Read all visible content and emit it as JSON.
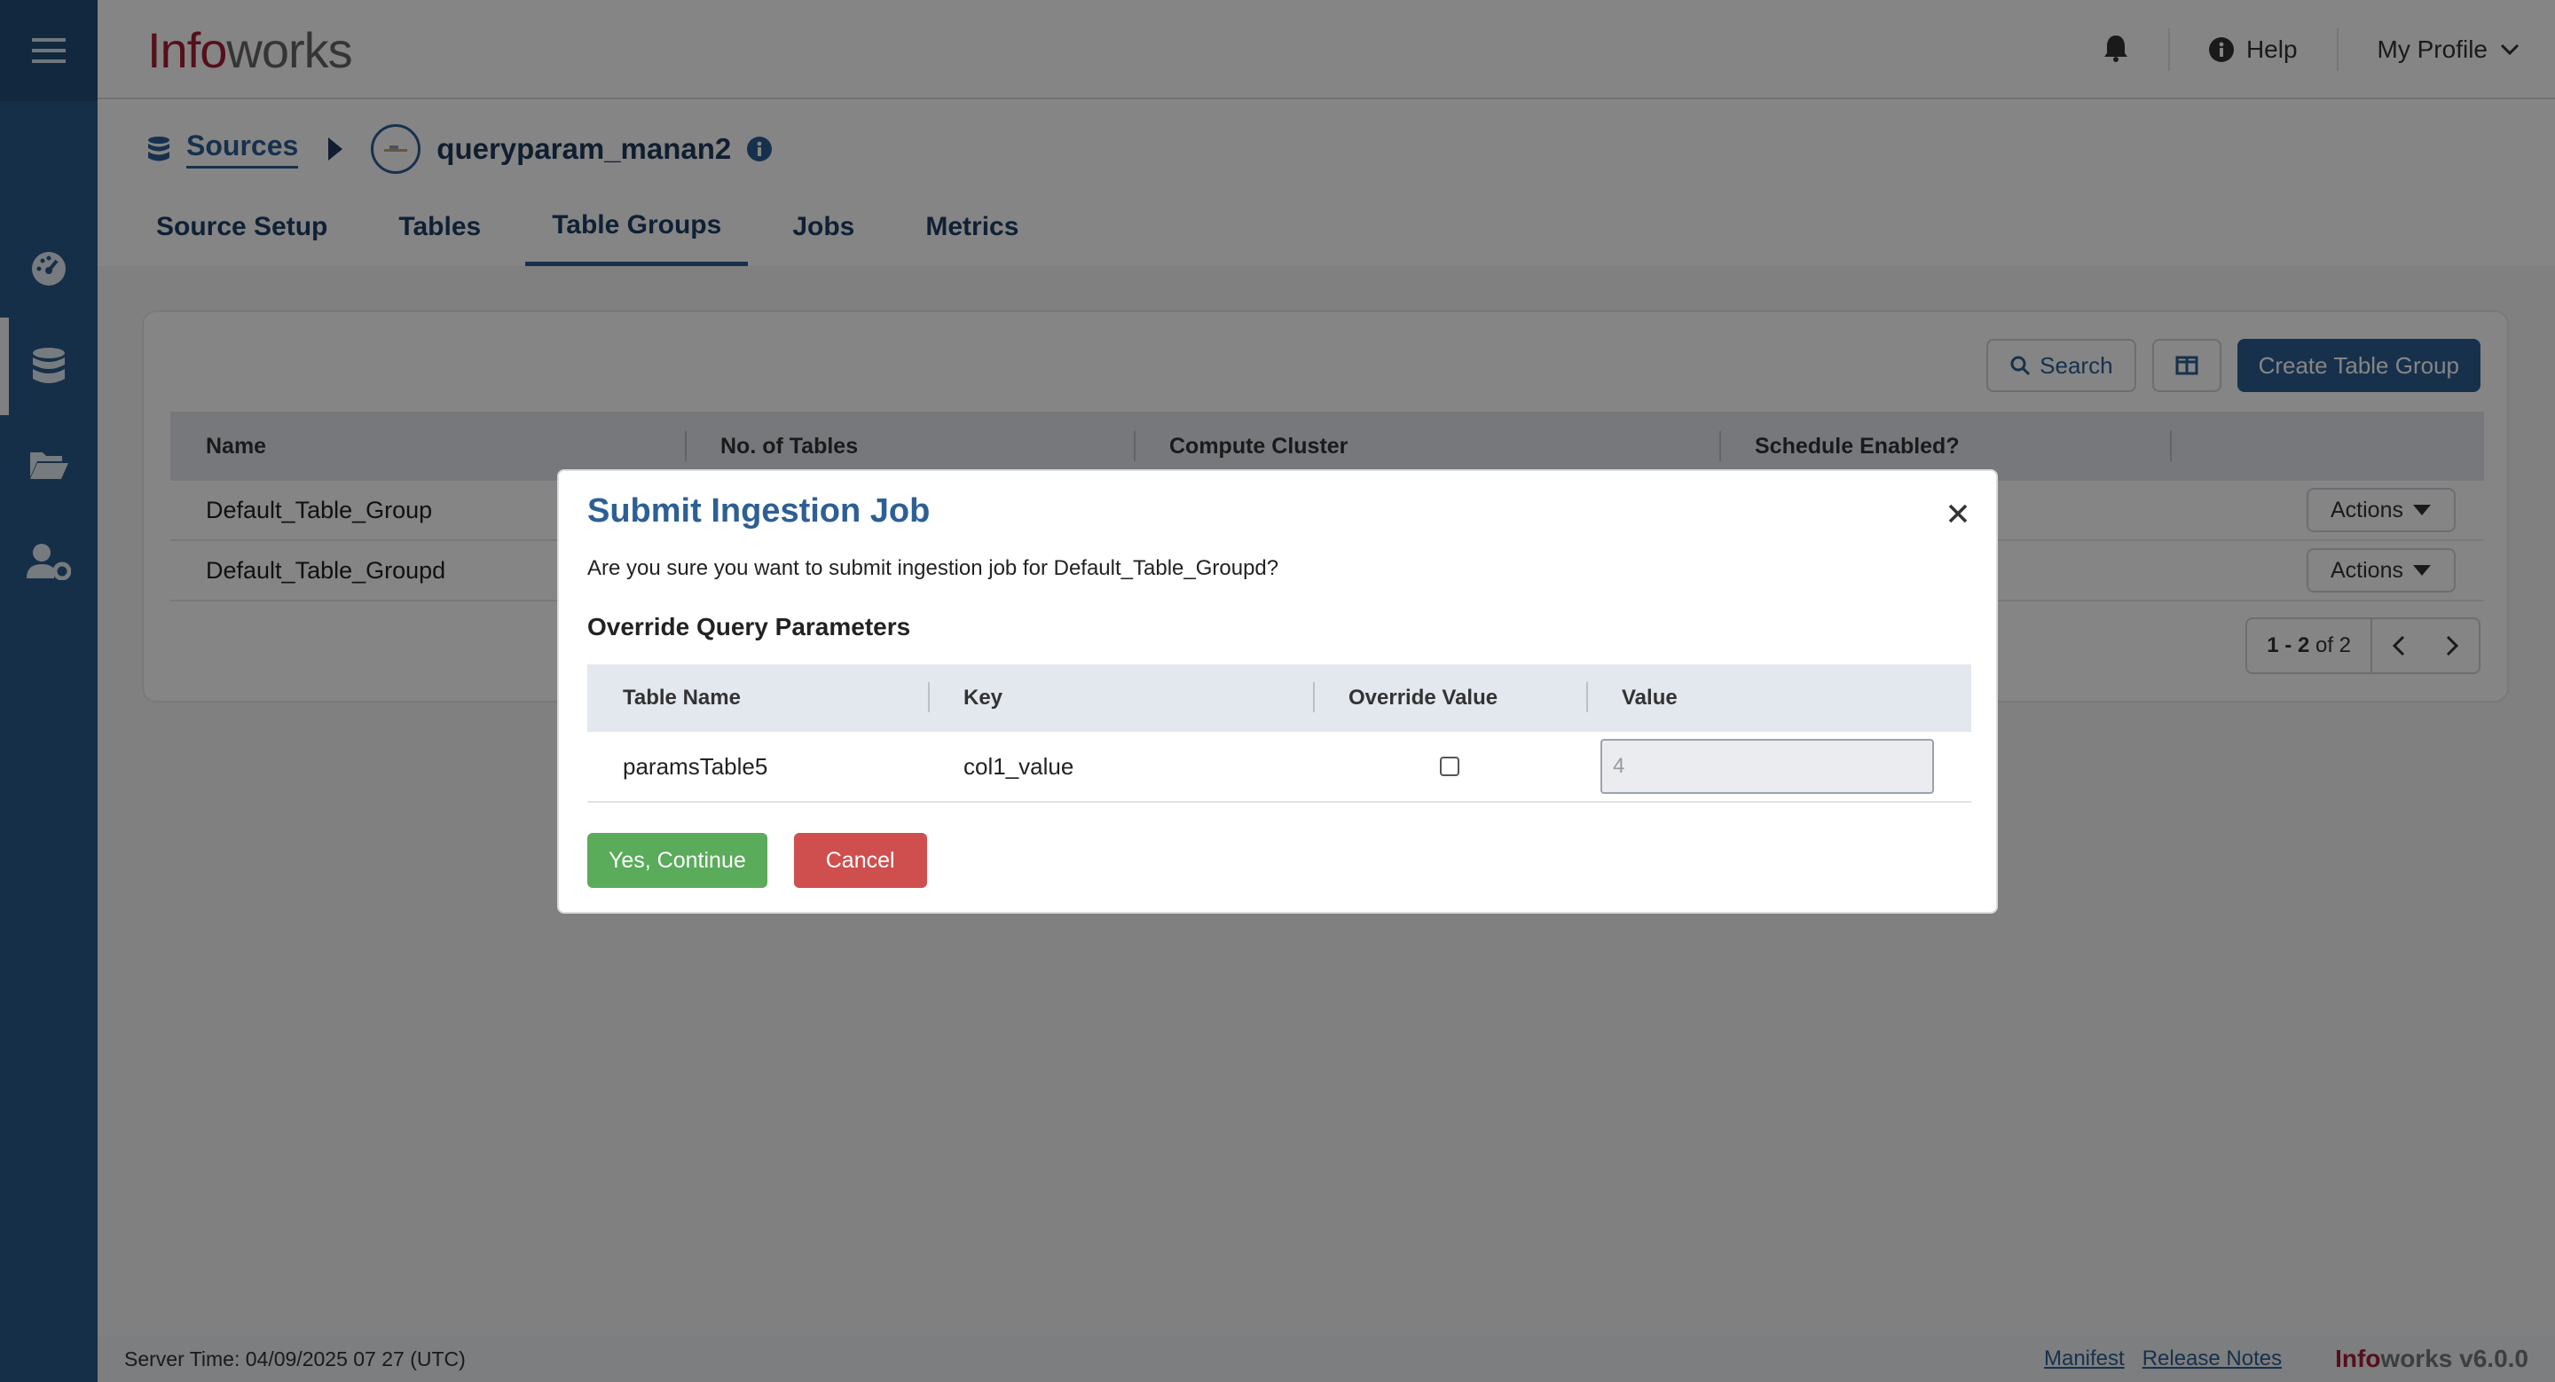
{
  "app": {
    "logo_info": "Info",
    "logo_works": "works"
  },
  "header": {
    "help_label": "Help",
    "profile_label": "My Profile"
  },
  "breadcrumb": {
    "root": "Sources",
    "current": "queryparam_manan2"
  },
  "tabs": [
    {
      "label": "Source Setup"
    },
    {
      "label": "Tables"
    },
    {
      "label": "Table Groups",
      "active": true
    },
    {
      "label": "Jobs"
    },
    {
      "label": "Metrics"
    }
  ],
  "toolbar": {
    "search_label": "Search",
    "create_label": "Create Table Group"
  },
  "grid": {
    "columns": [
      "Name",
      "No. of Tables",
      "Compute Cluster",
      "Schedule Enabled?"
    ],
    "rows": [
      {
        "name": "Default_Table_Group",
        "actions": "Actions"
      },
      {
        "name": "Default_Table_Groupd",
        "actions": "Actions"
      }
    ],
    "pager_range": "1 - 2",
    "pager_total": "of 2"
  },
  "modal": {
    "title": "Submit Ingestion Job",
    "message": "Are you sure you want to submit ingestion job for Default_Table_Groupd?",
    "subtitle": "Override Query Parameters",
    "columns": [
      "Table Name",
      "Key",
      "Override Value",
      "Value"
    ],
    "rows": [
      {
        "table_name": "paramsTable5",
        "key": "col1_value",
        "override": false,
        "value": "4"
      }
    ],
    "confirm_label": "Yes, Continue",
    "cancel_label": "Cancel"
  },
  "footer": {
    "server_time": "Server Time: 04/09/2025 07 27 (UTC)",
    "manifest": "Manifest",
    "release_notes": "Release Notes",
    "brand_info": "Info",
    "brand_works": "works",
    "version": "v6.0.0"
  },
  "colors": {
    "primary": "#2d5f95",
    "sidebar": "#2b5a8b",
    "brand_red": "#a61e34",
    "success": "#5aab5a",
    "danger": "#cf4f4f"
  },
  "icons": {
    "menu": "hamburger-icon",
    "dashboard": "dashboard-gauge-icon",
    "sources": "database-icon",
    "files": "folder-open-icon",
    "admin": "user-settings-icon",
    "bell": "bell-icon",
    "help": "info-circle-icon"
  }
}
